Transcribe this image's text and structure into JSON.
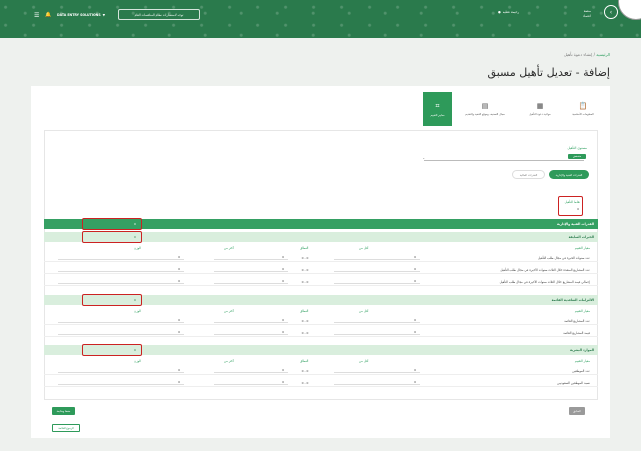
{
  "topbar": {
    "menu_icon": "☰",
    "bell_icon": "🔔",
    "company": "DATA ENTRY SOLUTIONS",
    "company_caret": "▼",
    "goto_button": "توجه لاستشارات نظام المنافسات العام",
    "user_name": "رحيمة عطيه",
    "user_icon": "user-icon",
    "logo_line1": "منصة",
    "logo_line2": "اعتماد",
    "logo_icon": "chevron-icon"
  },
  "breadcrumb": {
    "home": "الرئيسية",
    "separator": " / ",
    "current": "إنشاء دعوة تأهيل"
  },
  "page_title": "إضافة - تعديل تأهيل مسبق",
  "steps": [
    {
      "label": "المعلومات الأساسية",
      "icon": "clipboard-icon",
      "glyph": "📋"
    },
    {
      "label": "مواعيد دعوة التأهيل",
      "icon": "calendar-icon",
      "glyph": "▦"
    },
    {
      "label": "مجال التصنيف وموقع التنفيذ والتقديم",
      "icon": "table-icon",
      "glyph": "▤"
    },
    {
      "label": "معايير التقييم",
      "icon": "paperclip-icon",
      "glyph": "⌗"
    }
  ],
  "qualification_level": {
    "label": "مستوى التأهيل",
    "badge": "منخفض",
    "select_value": "-"
  },
  "tabs": {
    "active": "القدرات الفنية والإدارية",
    "inactive": "القدرات المالية"
  },
  "weight_field": {
    "label": "نقاط التأهيل",
    "value": "0"
  },
  "main_section": {
    "title": "القدرات الفنية والإدارية",
    "value": "0"
  },
  "columns": {
    "criteria": "معيار التقييم",
    "min": "أقل من",
    "range": "النطاق",
    "max": "أكثر من",
    "weight": "الوزن"
  },
  "sections": [
    {
      "title": "الخبرات السابقة",
      "value": "0",
      "rows": [
        {
          "criteria": "عدد سنوات الخبرة في مجال طلب التأهيل",
          "min": "0",
          "range": "0 - 0",
          "max": "0",
          "weight": "0"
        },
        {
          "criteria": "عدد المشاريع المنفذة خلال الثلاث سنوات الأخيرة في مجال طلب التأهيل",
          "min": "0",
          "range": "0 - 0",
          "max": "0",
          "weight": "0"
        },
        {
          "criteria": "إجمالي قيمة المشاريع خلال الثلاث سنوات الأخيرة في مجال طلب التأهيل",
          "min": "0",
          "range": "0 - 0",
          "max": "0",
          "weight": "0"
        }
      ]
    },
    {
      "title": "الالتزامات التعاقدية القائمة",
      "value": "0",
      "rows": [
        {
          "criteria": "عدد المشاريع القائمة",
          "min": "0",
          "range": "0 - 0",
          "max": "0",
          "weight": "0"
        },
        {
          "criteria": "قيمة المشاريع القائمة",
          "min": "0",
          "range": "0 - 0",
          "max": "0",
          "weight": "0"
        }
      ]
    },
    {
      "title": "الموارد البشرية",
      "value": "0",
      "rows": [
        {
          "criteria": "عدد الموظفين",
          "min": "0",
          "range": "0 - 0",
          "max": "0",
          "weight": "0"
        },
        {
          "criteria": "نسبة الموظفين السعوديين",
          "min": "0",
          "range": "0 - 0",
          "max": "0",
          "weight": "0"
        }
      ]
    }
  ],
  "buttons": {
    "save": "حفظ ومتابعة",
    "back_list": "الرجوع للقائمة",
    "previous": "السابق"
  },
  "colors": {
    "brand": "#2a7a4c",
    "accent": "#2e9a5a",
    "section_light": "#d9eedd",
    "error_outline": "#cc2222"
  }
}
